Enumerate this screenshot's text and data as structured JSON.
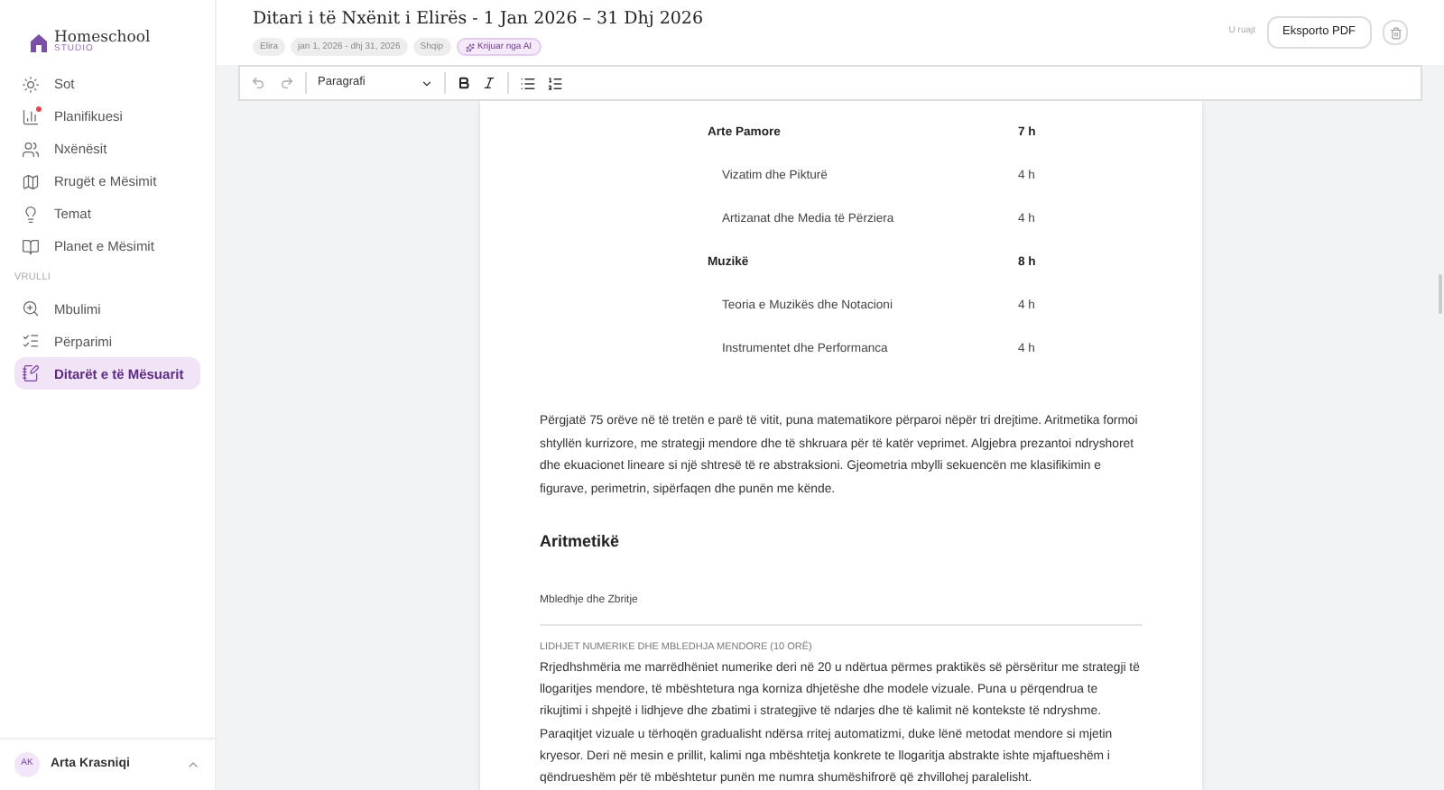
{
  "sidebar": {
    "brand": "Homeschool",
    "brand_sub": "STUDIO",
    "items": [
      {
        "label": "Sot",
        "selected": false,
        "badge": false
      },
      {
        "label": "Planifikuesi",
        "selected": false,
        "badge": true
      },
      {
        "label": "Nxënësit",
        "selected": false,
        "badge": false
      },
      {
        "label": "Rrugët e Mësimit",
        "selected": false,
        "badge": false
      },
      {
        "label": "Temat",
        "selected": false,
        "badge": false
      },
      {
        "label": "Planet e Mësimit",
        "selected": false,
        "badge": false
      }
    ],
    "section": "VRULLI",
    "section_items": [
      {
        "label": "Mbulimi",
        "selected": false,
        "badge": false
      },
      {
        "label": "Përparimi",
        "selected": false,
        "badge": false
      },
      {
        "label": "Ditarët e të Mësuarit",
        "selected": true,
        "badge": false
      }
    ],
    "user": {
      "initials": "AK",
      "name": "Arta Krasniqi"
    }
  },
  "header": {
    "title": "Ditari i të Nxënit i Elirës - 1 Jan 2026 – 31 Dhj 2026",
    "tags": [
      {
        "label": "Elira",
        "kind": "plain"
      },
      {
        "label": "jan 1, 2026 - dhj 31, 2026",
        "kind": "plain"
      },
      {
        "label": "Shqip",
        "kind": "plain"
      },
      {
        "label": "Krijuar nga AI",
        "kind": "ai"
      }
    ],
    "status": "U ruajt",
    "export_button": "Eksporto PDF"
  },
  "toolbar": {
    "block_style": "Paragrafi"
  },
  "document": {
    "hours": [
      {
        "name": "Arte Pamore",
        "hours": "7 h",
        "kind": "group"
      },
      {
        "name": "Vizatim dhe Pikturë",
        "hours": "4 h",
        "kind": "sub"
      },
      {
        "name": "Artizanat dhe Media të Përziera",
        "hours": "4 h",
        "kind": "sub"
      },
      {
        "name": "Muzikë",
        "hours": "8 h",
        "kind": "group"
      },
      {
        "name": "Teoria e Muzikës dhe Notacioni",
        "hours": "4 h",
        "kind": "sub"
      },
      {
        "name": "Instrumentet dhe Performanca",
        "hours": "4 h",
        "kind": "sub"
      }
    ],
    "intro": "Përgjatë 75 orëve në të tretën e parë të vitit, puna matematikore përparoi nëpër tri drejtime. Aritmetika formoi shtyllën kurrizore, me strategji mendore dhe të shkruara për të katër veprimet. Algjebra prezantoi ndryshoret dhe ekuacionet lineare si një shtresë të re abstraksioni. Gjeometria mbylli sekuencën me klasifikimin e figurave, perimetrin, sipërfaqen dhe punën me kënde.",
    "heading": "Aritmetikë",
    "subheading": "Mbledhje dhe Zbritje",
    "label": "LIDHJET NUMERIKE DHE MBLEDHJA MENDORE (10 ORË)",
    "body": "Rrjedhshmëria me marrëdhëniet numerike deri në 20 u ndërtua përmes praktikës së përsëritur me strategji të llogaritjes mendore, të mbështetura nga korniza dhjetëshe dhe modele vizuale. Puna u përqendrua te rikujtimi i shpejtë i lidhjeve dhe zbatimi i strategjive të ndarjes dhe të kalimit në kontekste të ndryshme. Paraqitjet vizuale u tërhoqën gradualisht ndërsa rritej automatizmi, duke lënë metodat mendore si mjetin kryesor. Deri në mesin e prillit, kalimi nga mbështetja konkrete te llogaritja abstrakte ishte mjaftueshëm i qëndrueshëm për të mbështetur punën me numra shumëshifrorë që zhvillohej paralelisht."
  }
}
